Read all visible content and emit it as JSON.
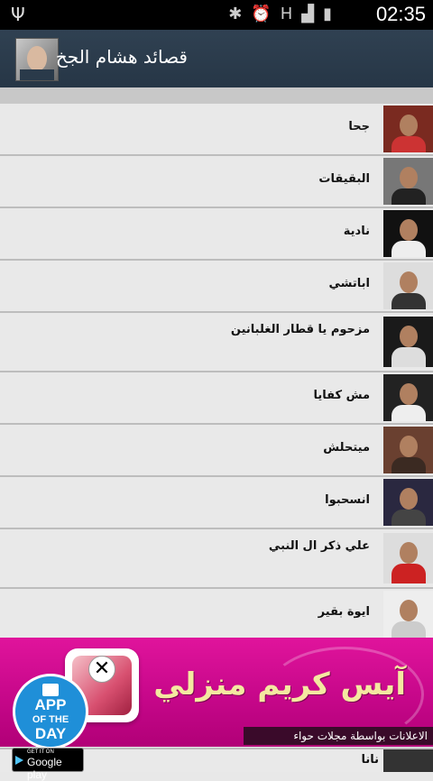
{
  "status": {
    "time": "02:35"
  },
  "app": {
    "title": "قصائد هشام الجخ"
  },
  "items": [
    {
      "label": "جحا"
    },
    {
      "label": "البقيقات"
    },
    {
      "label": "نادية"
    },
    {
      "label": "اباتشي"
    },
    {
      "label": "مزحوم يا قطار الغلبانين"
    },
    {
      "label": "مش كفايا"
    },
    {
      "label": "ميتحلش"
    },
    {
      "label": "انسحبوا"
    },
    {
      "label": "علي ذكر ال النبي"
    },
    {
      "label": "ايوة بقير"
    }
  ],
  "partial_item": {
    "label": "نانا"
  },
  "ad": {
    "headline": "آيس كريم منزلي",
    "strip_text": "الاعلانات بواسطة مجلات حواء",
    "badge_line1": "APP",
    "badge_line2": "OF THE",
    "badge_line3": "DAY",
    "close": "✕"
  },
  "googleplay": {
    "small": "GET IT ON",
    "big": "Google play"
  },
  "colors": {
    "appbar": "#304152",
    "ad_bg": "#d00c92"
  }
}
